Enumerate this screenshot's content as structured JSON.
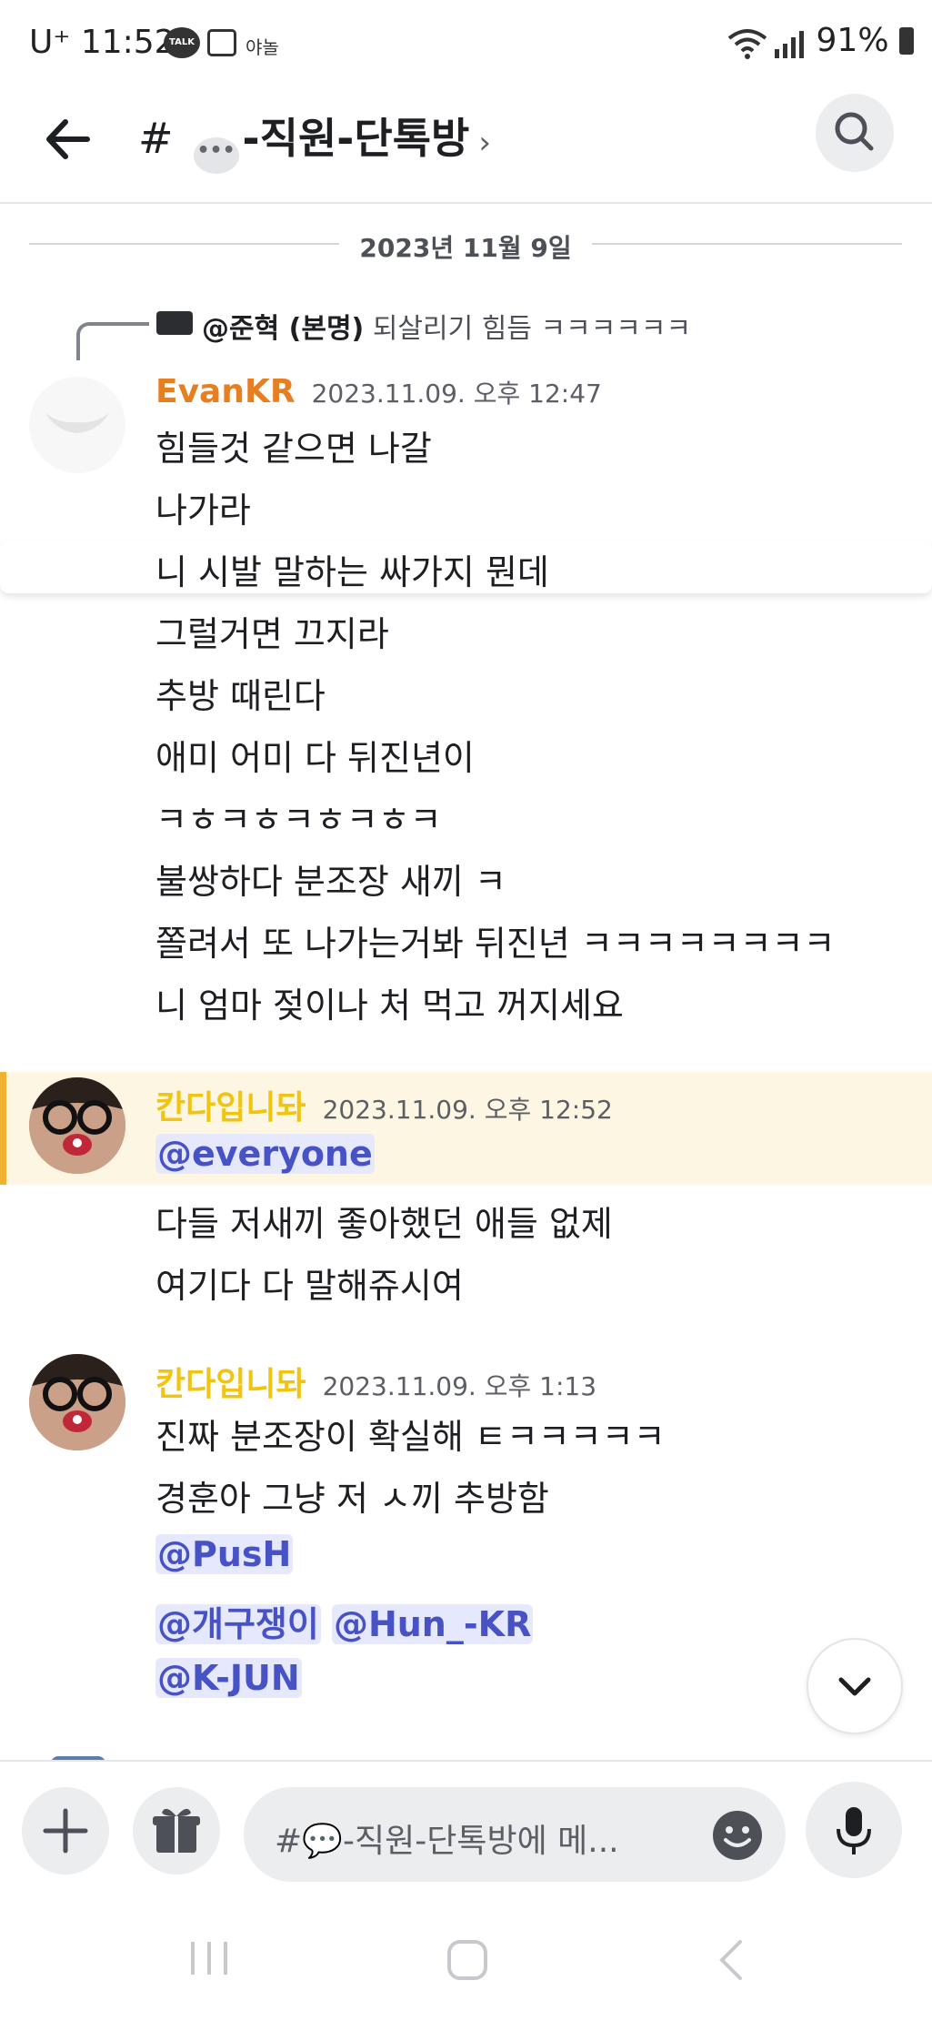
{
  "status_bar": {
    "carrier": "U⁺",
    "time": "11:52",
    "notif_talk": "TALK",
    "notif_app": "야놀",
    "battery": "91%",
    "icons": [
      "kakaotalk-icon",
      "gallery-icon",
      "app-icon",
      "wifi-icon",
      "signal-icon",
      "battery-icon"
    ]
  },
  "header": {
    "hash": "#",
    "channel_name": "-직원-단톡방",
    "channel_emoji": "speech-bubble-icon",
    "chevron": "›"
  },
  "date_divider": "2023년 11월 9일",
  "reply": {
    "user": "@준혁 (본명)",
    "text": "되살리기 힘듬 ㅋㅋㅋㅋㅋㅋ"
  },
  "messages": [
    {
      "author": "EvanKR",
      "author_color": "#e67e22",
      "timestamp": "2023.11.09. 오후 12:47",
      "lines": [
        "힘들것 같으면 나갈",
        "나가라",
        "니 시발 말하는 싸가지 뭔데",
        "그럴거면 끄지라",
        "추방 때린다",
        "애미 어미 다 뒤진년이",
        "ㅋㅎㅋㅎㅋㅎㅋㅎㅋ",
        "불쌍하다 분조장 새끼 ㅋ",
        "쫄려서 또 나가는거봐 뒤진년 ㅋㅋㅋㅋㅋㅋㅋㅋ",
        "니 엄마 젖이나 처 먹고 꺼지세요"
      ]
    },
    {
      "author": "칸다입니돠",
      "author_color": "#f1c40f",
      "timestamp": "2023.11.09. 오후 12:52",
      "mention": "@everyone",
      "lines": [
        "다들 저새끼 좋아했던 애들 없제",
        "여기다 다 말해쥬시여"
      ]
    },
    {
      "author": "칸다입니돠",
      "author_color": "#f1c40f",
      "timestamp": "2023.11.09. 오후 1:13",
      "lines": [
        "진짜 분조장이 확실해 ㅌㅋㅋㅋㅋㅋ",
        "경훈아 그냥 저 ㅅ끼 추방함"
      ],
      "mentions": [
        "@PusH",
        "@개구쟁이",
        "@Hun_-KR",
        "@K-JUN"
      ]
    }
  ],
  "composer": {
    "placeholder": "#💬-직원-단톡방에 메...",
    "icons": [
      "plus-icon",
      "gift-icon",
      "emoji-icon",
      "microphone-icon"
    ]
  },
  "colors": {
    "mention_bg": "#e6e8fd",
    "mention_text": "#4752c4",
    "highlight_bg": "#fdf6e3",
    "highlight_bar": "#f0b232"
  }
}
